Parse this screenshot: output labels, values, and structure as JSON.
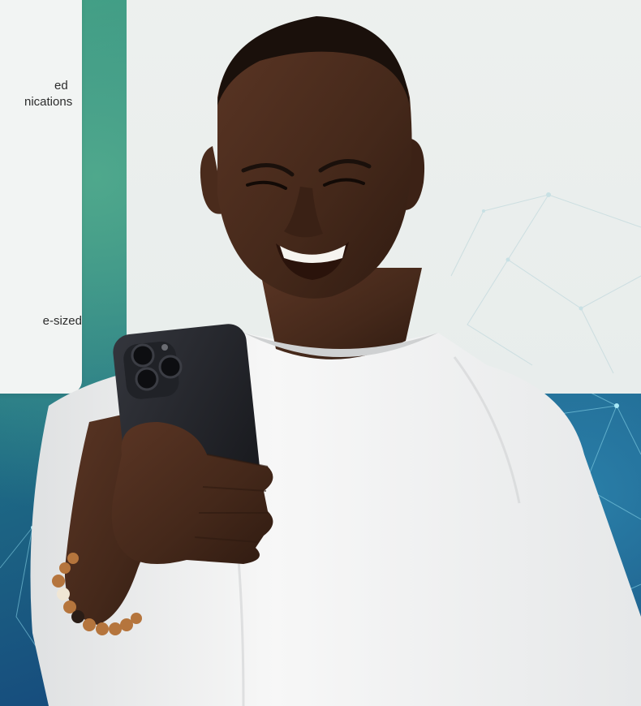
{
  "left_card": {
    "line_1": "ed",
    "line_2": "nications",
    "line_3": "e-sized"
  },
  "photo": {
    "subject": "smiling man in white t-shirt looking at smartphone",
    "accessory": "wooden bead bracelet"
  },
  "colors": {
    "background_teal": "#3a9a7f",
    "background_blue": "#174f7e",
    "card_bg": "#eef1f0",
    "network_line": "#7fd0e6",
    "shirt": "#f4f4f4",
    "skin": "#4a2c1c",
    "phone": "#1c1d22"
  }
}
